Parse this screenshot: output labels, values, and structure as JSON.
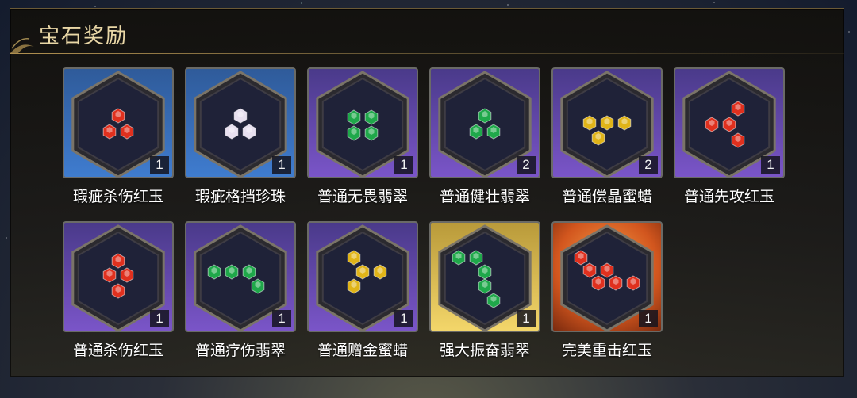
{
  "panel": {
    "title": "宝石奖励"
  },
  "colors": {
    "red": "#e0301e",
    "pearl": "#e8e0f0",
    "green": "#1fa84a",
    "gold": "#e0b418"
  },
  "rewards": [
    {
      "name": "瑕疵杀伤红玉",
      "count": "1",
      "rarity": "blue",
      "gem": "red",
      "shape": "tri"
    },
    {
      "name": "瑕疵格挡珍珠",
      "count": "1",
      "rarity": "blue",
      "gem": "pearl",
      "shape": "tri"
    },
    {
      "name": "普通无畏翡翠",
      "count": "1",
      "rarity": "purple",
      "gem": "green",
      "shape": "square"
    },
    {
      "name": "普通健壮翡翠",
      "count": "2",
      "rarity": "purple",
      "gem": "green",
      "shape": "triup"
    },
    {
      "name": "普通偿晶蜜蜡",
      "count": "2",
      "rarity": "purple",
      "gem": "gold",
      "shape": "triup3"
    },
    {
      "name": "普通先攻红玉",
      "count": "1",
      "rarity": "purple",
      "gem": "red",
      "shape": "zig"
    },
    {
      "name": "普通杀伤红玉",
      "count": "1",
      "rarity": "purple",
      "gem": "red",
      "shape": "column"
    },
    {
      "name": "普通疗伤翡翠",
      "count": "1",
      "rarity": "purple",
      "gem": "green",
      "shape": "row"
    },
    {
      "name": "普通赠金蜜蜡",
      "count": "1",
      "rarity": "purple",
      "gem": "gold",
      "shape": "branch"
    },
    {
      "name": "强大振奋翡翠",
      "count": "1",
      "rarity": "gold",
      "gem": "green",
      "shape": "snake"
    },
    {
      "name": "完美重击红玉",
      "count": "1",
      "rarity": "orange",
      "gem": "red",
      "shape": "stair"
    }
  ]
}
